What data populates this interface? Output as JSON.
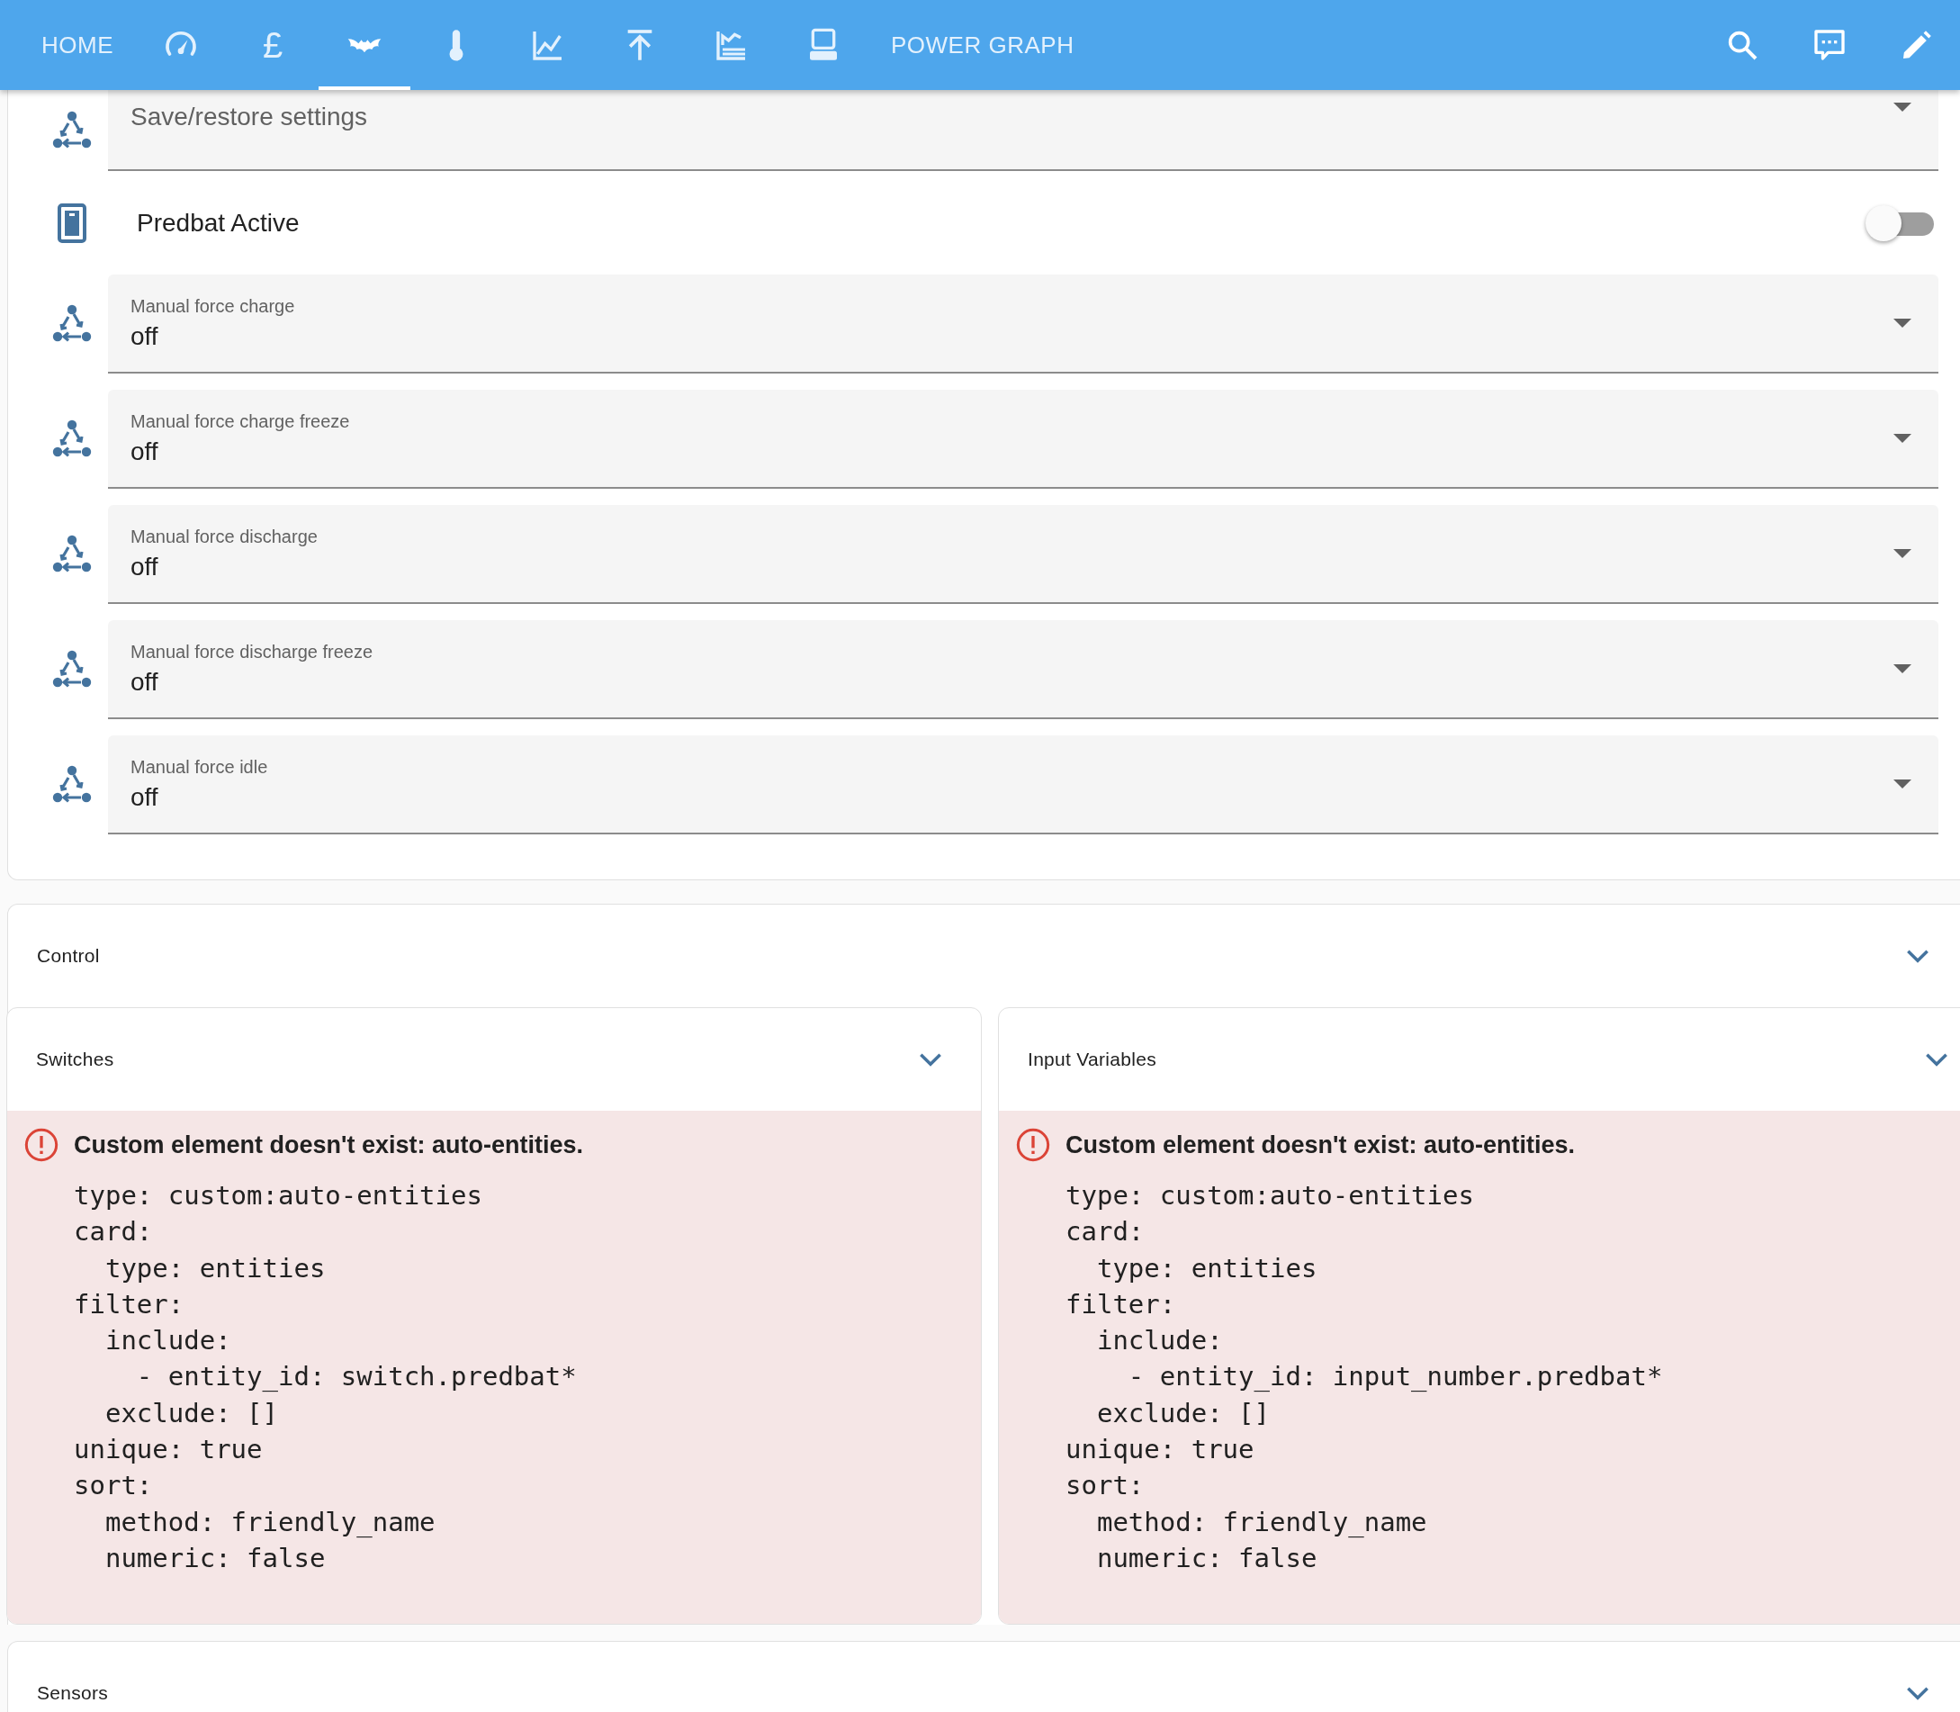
{
  "top_bar": {
    "tabs": [
      {
        "kind": "text",
        "label": "HOME",
        "selected": false
      },
      {
        "kind": "gauge",
        "selected": false
      },
      {
        "kind": "glyph",
        "label": "£",
        "selected": false
      },
      {
        "kind": "bat",
        "selected": true
      },
      {
        "kind": "thermometer",
        "selected": false
      },
      {
        "kind": "line-chart",
        "selected": false
      },
      {
        "kind": "arrow-up",
        "selected": false
      },
      {
        "kind": "area-chart",
        "selected": false
      },
      {
        "kind": "computer",
        "selected": false
      },
      {
        "kind": "text",
        "label": "POWER GRAPH",
        "selected": false
      }
    ],
    "actions": [
      {
        "kind": "search"
      },
      {
        "kind": "chat"
      },
      {
        "kind": "pencil"
      }
    ]
  },
  "entities_card": {
    "rows": [
      {
        "kind": "select",
        "label": "Save/restore settings"
      },
      {
        "kind": "toggle",
        "label": "Predbat Active",
        "on": false
      },
      {
        "kind": "select",
        "label": "Manual force charge",
        "value": "off"
      },
      {
        "kind": "select",
        "label": "Manual force charge freeze",
        "value": "off"
      },
      {
        "kind": "select",
        "label": "Manual force discharge",
        "value": "off"
      },
      {
        "kind": "select",
        "label": "Manual force discharge freeze",
        "value": "off"
      },
      {
        "kind": "select",
        "label": "Manual force idle",
        "value": "off"
      }
    ]
  },
  "control": {
    "title": "Control",
    "panels": [
      {
        "title": "Switches",
        "error": "Custom element doesn't exist: auto-entities.",
        "config": "type: custom:auto-entities\ncard:\n  type: entities\nfilter:\n  include:\n    - entity_id: switch.predbat*\n  exclude: []\nunique: true\nsort:\n  method: friendly_name\n  numeric: false"
      },
      {
        "title": "Input Variables",
        "error": "Custom element doesn't exist: auto-entities.",
        "config": "type: custom:auto-entities\ncard:\n  type: entities\nfilter:\n  include:\n    - entity_id: input_number.predbat*\n  exclude: []\nunique: true\nsort:\n  method: friendly_name\n  numeric: false"
      }
    ]
  },
  "sensors": {
    "title": "Sensors"
  }
}
